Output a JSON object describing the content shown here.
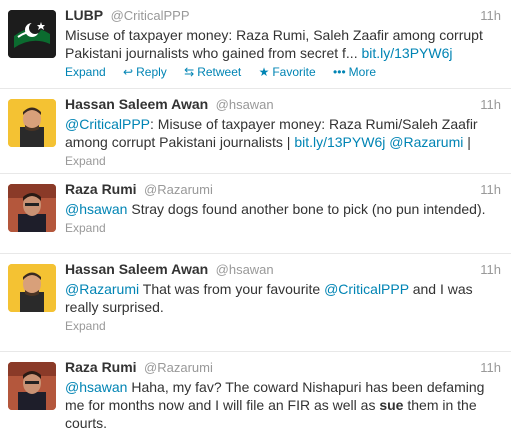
{
  "tweets": [
    {
      "fullname": "LUBP",
      "username": "@CriticalPPP",
      "time": "11h",
      "text_part1": "Misuse of taxpayer money: Raza Rumi, Saleh Zaafir among corrupt Pakistani journalists who gained from secret f... ",
      "link1": "bit.ly/13PYW6j",
      "actions": {
        "expand": "Expand",
        "reply": "Reply",
        "retweet": "Retweet",
        "favorite": "Favorite",
        "more": "More"
      },
      "avatar_icon": "pakistan-flag-avatar"
    },
    {
      "fullname": "Hassan Saleem Awan",
      "username": "@hsawan",
      "time": "11h",
      "mention1": "@CriticalPPP",
      "text_part1": ": Misuse of taxpayer money: Raza Rumi/Saleh Zaafir among corrupt Pakistani journalists | ",
      "link1": "bit.ly/13PYW6j",
      "mention2": "@Razarumi",
      "text_part2": " |",
      "expand": "Expand"
    },
    {
      "fullname": "Raza Rumi",
      "username": "@Razarumi",
      "time": "11h",
      "mention1": "@hsawan",
      "text_part1": " Stray dogs found another bone to pick (no pun intended).",
      "expand": "Expand"
    },
    {
      "fullname": "Hassan Saleem Awan",
      "username": "@hsawan",
      "time": "11h",
      "mention1": "@Razarumi",
      "text_part1": " That was from your favourite ",
      "mention2": "@CriticalPPP",
      "text_part2": " and I was really surprised.",
      "expand": "Expand"
    },
    {
      "fullname": "Raza Rumi",
      "username": "@Razarumi",
      "time": "11h",
      "mention1": "@hsawan",
      "text_part1": " Haha, my fav? The coward Nishapuri has been defaming me for months now and I will file an FIR as well as ",
      "strong1": "sue",
      "text_part2": " them in the courts."
    }
  ],
  "colors": {
    "link": "#0084b4",
    "muted": "#999999",
    "text": "#333333"
  }
}
